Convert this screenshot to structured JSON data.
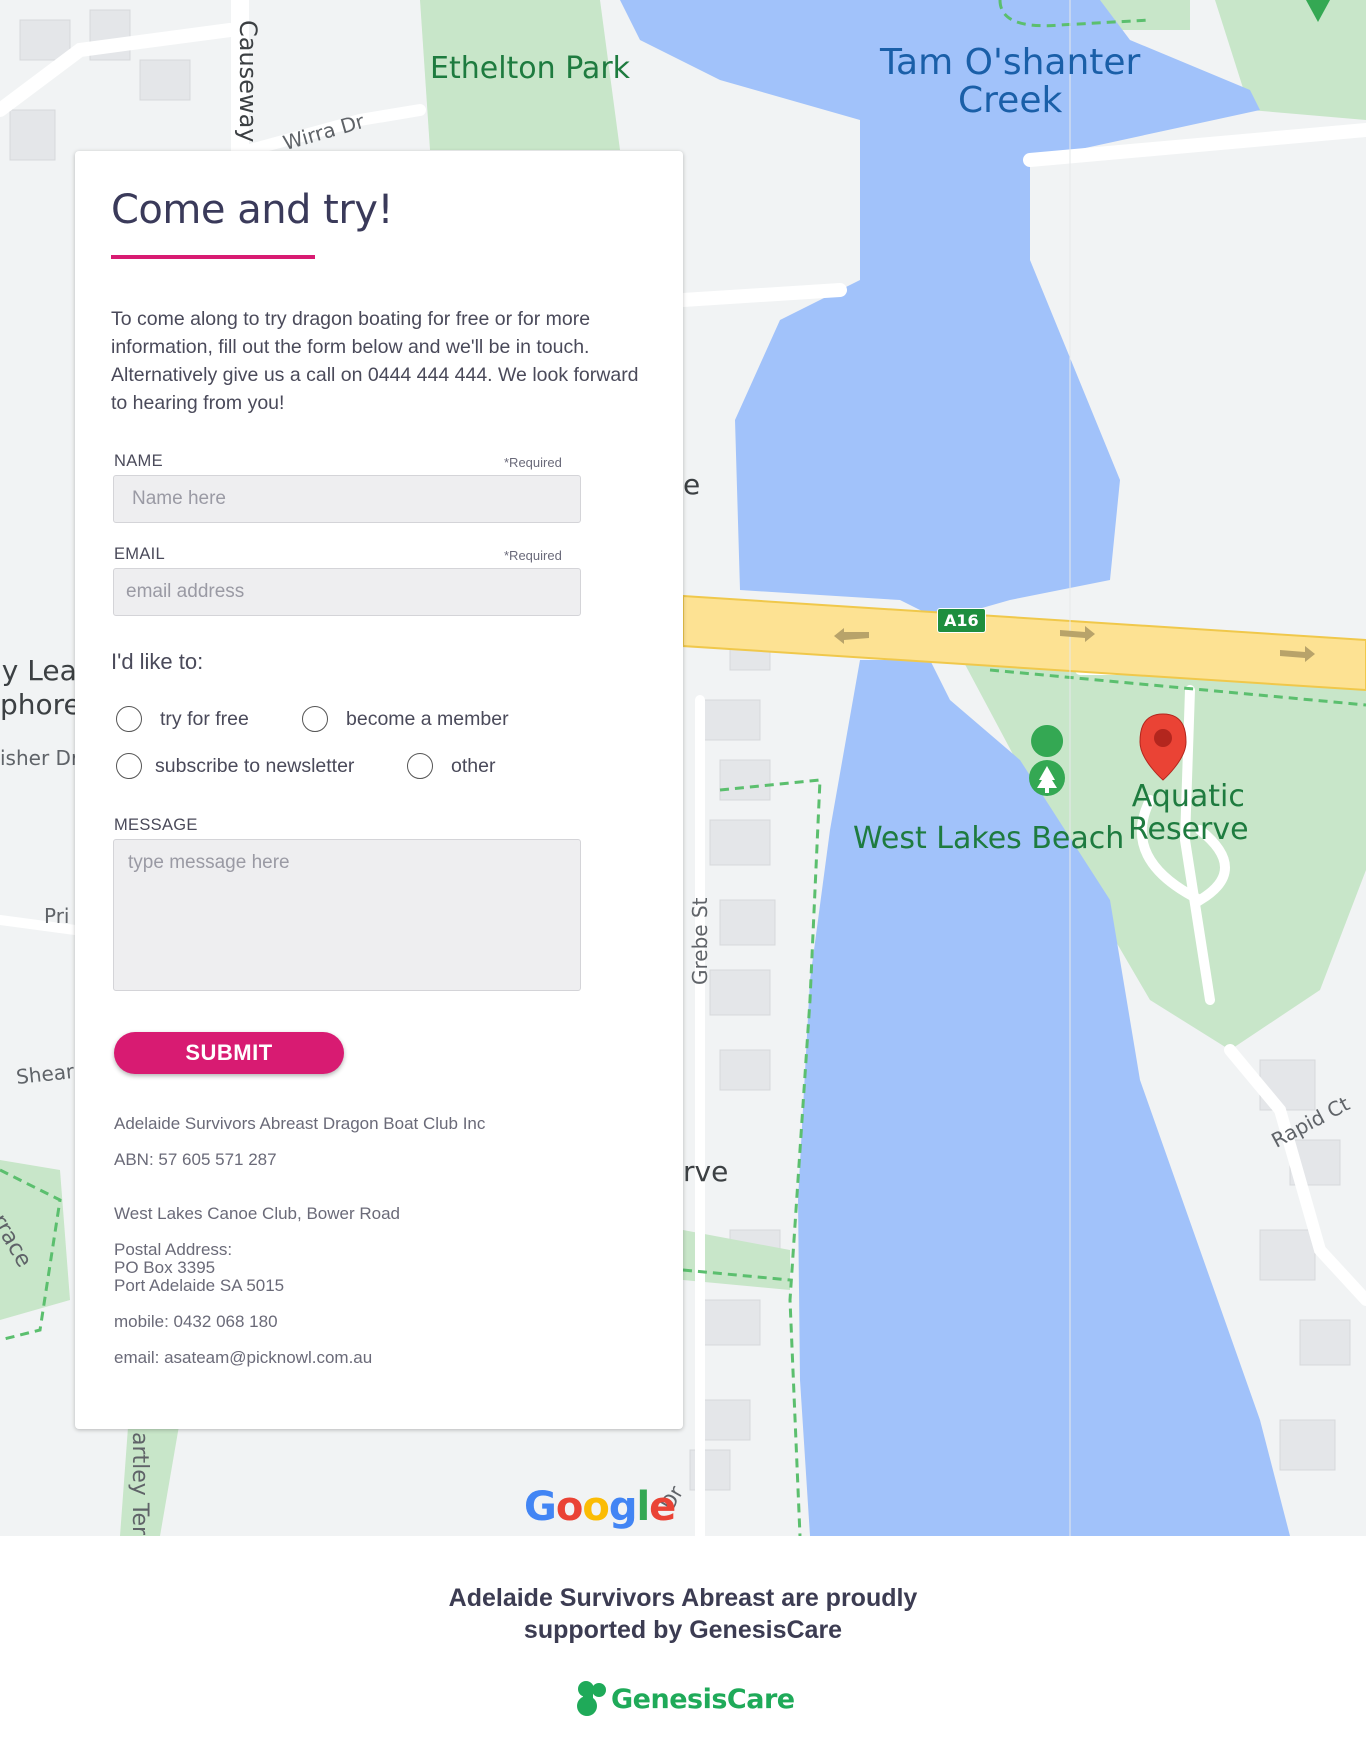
{
  "map": {
    "labels": {
      "ethelton_park": "Ethelton Park",
      "tam_oshanter_creek": "Tam O'shanter\nCreek",
      "causeway": "Causeway",
      "wirra_dr": "Wirra Dr",
      "west_lakes_beach": "West Lakes Beach",
      "aquatic_reserve": "Aquatic\nReserve",
      "a16": "A16",
      "grebe_st": "Grebe St",
      "rapid_ct": "Rapid Ct",
      "partial_lea": "ly Lea",
      "partial_phore": "phore",
      "partial_fisher": "isher Dr",
      "partial_pri": "Pri",
      "partial_shear": "Shear",
      "partial_race": "rrace",
      "partial_rtley": "artley Ter",
      "partial_e": "e",
      "partial_rve": "rve",
      "partial_dr": "Dr"
    },
    "google_letters": [
      "G",
      "o",
      "o",
      "g",
      "l",
      "e"
    ],
    "colors": {
      "water": "#a1c2fa",
      "park": "#c8e6c9",
      "highway": "#fde293",
      "marker": "#ea4335"
    }
  },
  "form": {
    "title": "Come and try!",
    "intro": "To come along to try dragon boating for free or for more information, fill out the form below and we'll be in touch. Alternatively give us a call on 0444 444 444. We look forward to hearing from you!",
    "name_label": "NAME",
    "name_required": "*Required",
    "name_placeholder": "Name here",
    "email_label": "EMAIL",
    "email_required": "*Required",
    "email_placeholder": "email address",
    "like_label": "I'd like to:",
    "options": [
      "try for free",
      "become a member",
      "subscribe to newsletter",
      "other"
    ],
    "message_label": "MESSAGE",
    "message_placeholder": "type message here",
    "submit_label": "SUBMIT",
    "accent_color": "#d81b72"
  },
  "contact": {
    "club_name": "Adelaide Survivors Abreast Dragon Boat Club Inc",
    "abn": "ABN: 57 605 571 287",
    "location": "West Lakes Canoe Club, Bower Road",
    "postal_label": "Postal Address:",
    "postal_line1": "PO Box 3395",
    "postal_line2": "Port Adelaide SA 5015",
    "mobile": "mobile: 0432 068 180",
    "email": "email: asateam@picknowl.com.au"
  },
  "footer": {
    "support_line1": "Adelaide Survivors Abreast are proudly",
    "support_line2": "supported by GenesisCare",
    "sponsor_name": "GenesisCare",
    "sponsor_color": "#1faa59"
  }
}
